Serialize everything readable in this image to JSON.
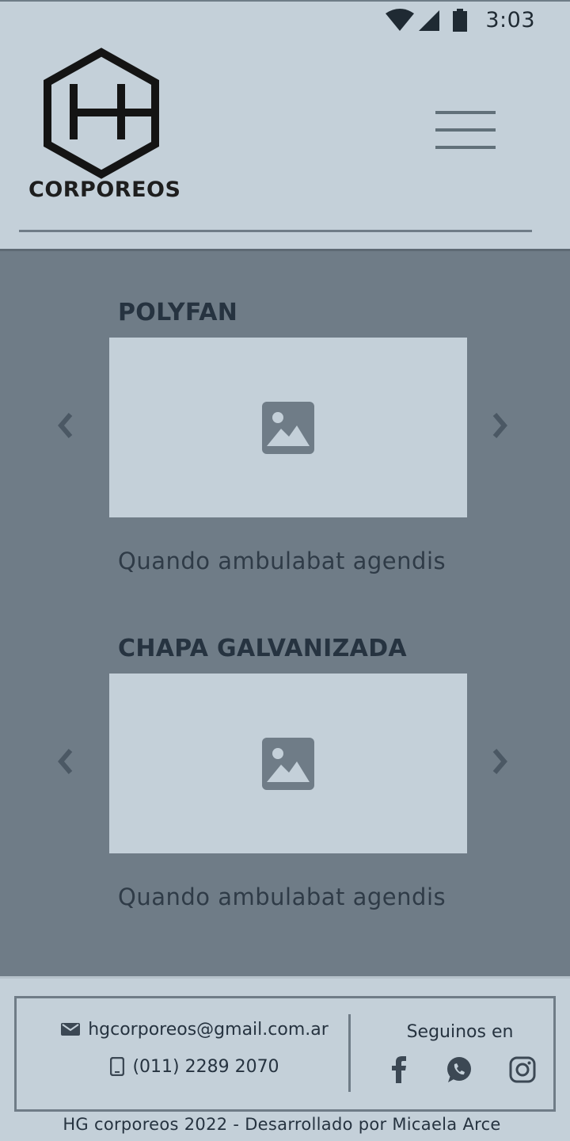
{
  "status_bar": {
    "time": "3:03",
    "icons": [
      "wifi-icon",
      "signal-icon",
      "battery-icon"
    ]
  },
  "header": {
    "logo_text": "CORPOREOS",
    "menu_icon": "hamburger-menu-icon"
  },
  "products": [
    {
      "title": "POLYFAN",
      "image_icon": "image-placeholder-icon",
      "description": "Quando ambulabat agendis"
    },
    {
      "title": "CHAPA GALVANIZADA",
      "image_icon": "image-placeholder-icon",
      "description": "Quando ambulabat agendis"
    }
  ],
  "footer": {
    "email": "hgcorporeos@gmail.com.ar",
    "phone": "(011) 2289 2070",
    "social_title": "Seguinos en",
    "social_icons": [
      "facebook-icon",
      "whatsapp-icon",
      "instagram-icon"
    ],
    "copyright": "HG corporeos 2022 - Desarrollado por Micaela Arce"
  },
  "colors": {
    "background": "#c4d0d9",
    "main": "#6f7c87",
    "text": "#263340"
  }
}
